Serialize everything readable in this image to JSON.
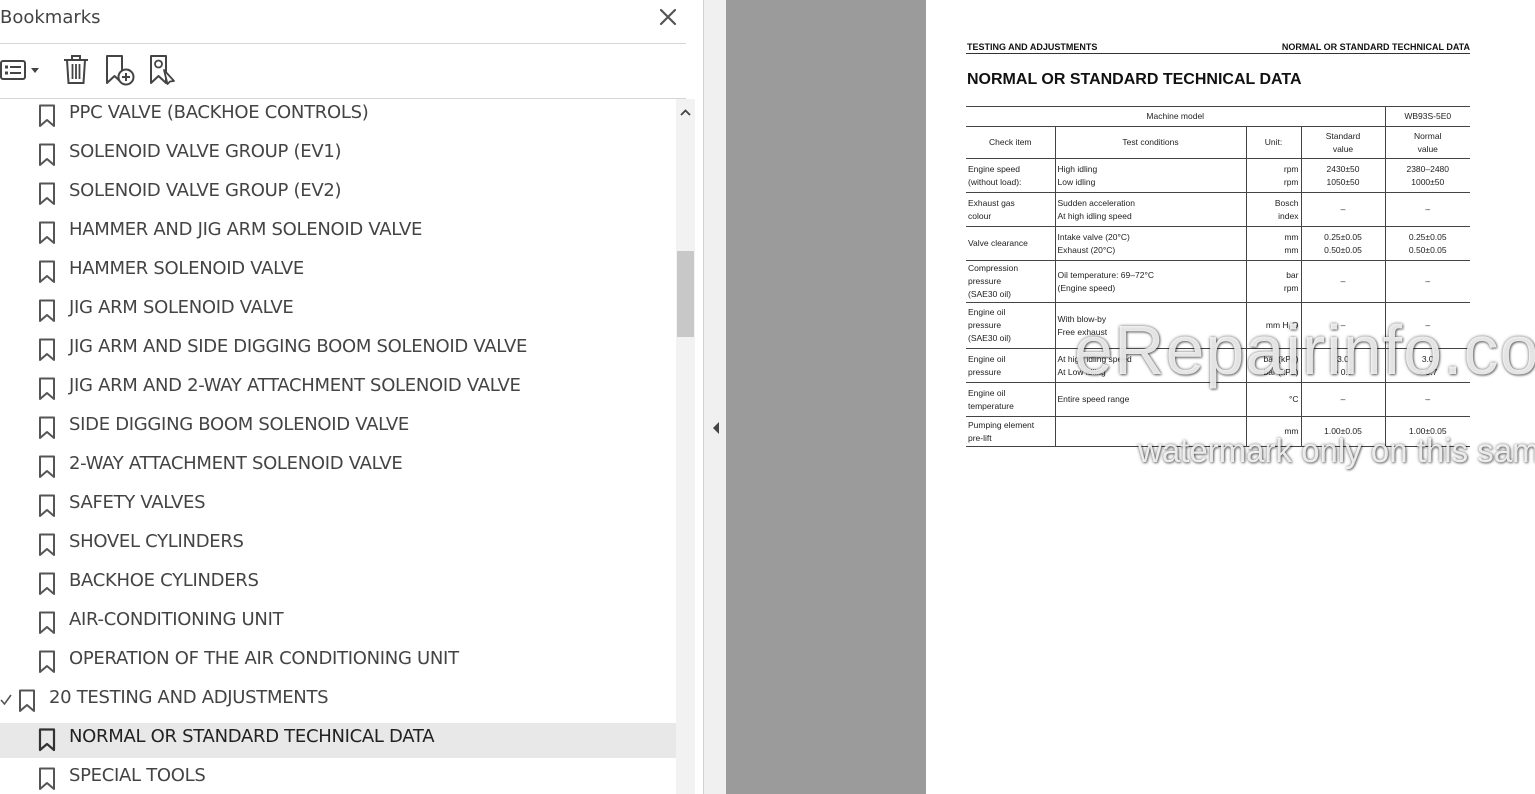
{
  "panel": {
    "title": "Bookmarks",
    "toolbar": {
      "options_icon": "list-options-icon",
      "delete_icon": "trash-icon",
      "new_bookmark_icon": "new-bookmark-icon",
      "find_bookmark_icon": "find-current-bookmark-icon"
    },
    "items": [
      {
        "label": "PPC VALVE (BACKHOE CONTROLS)",
        "level": 2,
        "selected": false
      },
      {
        "label": "SOLENOID VALVE GROUP (EV1)",
        "level": 2,
        "selected": false
      },
      {
        "label": "SOLENOID VALVE GROUP (EV2)",
        "level": 2,
        "selected": false
      },
      {
        "label": "HAMMER AND JIG ARM SOLENOID VALVE",
        "level": 2,
        "selected": false
      },
      {
        "label": "HAMMER SOLENOID VALVE",
        "level": 2,
        "selected": false
      },
      {
        "label": "JIG ARM SOLENOID VALVE",
        "level": 2,
        "selected": false
      },
      {
        "label": "JIG ARM AND SIDE DIGGING BOOM SOLENOID VALVE",
        "level": 2,
        "selected": false
      },
      {
        "label": "JIG ARM AND 2-WAY ATTACHMENT SOLENOID VALVE",
        "level": 2,
        "selected": false
      },
      {
        "label": "SIDE DIGGING BOOM SOLENOID VALVE",
        "level": 2,
        "selected": false
      },
      {
        "label": "2-WAY ATTACHMENT SOLENOID VALVE",
        "level": 2,
        "selected": false
      },
      {
        "label": "SAFETY VALVES",
        "level": 2,
        "selected": false
      },
      {
        "label": "SHOVEL CYLINDERS",
        "level": 2,
        "selected": false
      },
      {
        "label": "BACKHOE CYLINDERS",
        "level": 2,
        "selected": false
      },
      {
        "label": "AIR-CONDITIONING UNIT",
        "level": 2,
        "selected": false
      },
      {
        "label": "OPERATION OF THE AIR CONDITIONING UNIT",
        "level": 2,
        "selected": false
      },
      {
        "label": "20 TESTING AND ADJUSTMENTS",
        "level": 1,
        "selected": false,
        "expanded": true
      },
      {
        "label": "NORMAL OR STANDARD TECHNICAL DATA",
        "level": 2,
        "selected": true
      },
      {
        "label": "SPECIAL TOOLS",
        "level": 2,
        "selected": false
      }
    ]
  },
  "document": {
    "header_left": "TESTING AND ADJUSTMENTS",
    "header_right": "NORMAL OR STANDARD TECHNICAL DATA",
    "title": "NORMAL OR STANDARD TECHNICAL DATA",
    "table": {
      "machine_model_label": "Machine model",
      "machine_model_value": "WB93S-5E0",
      "col_check_item": "Check item",
      "col_test_conditions": "Test conditions",
      "col_unit": "Unit:",
      "col_standard": [
        "Standard",
        "value"
      ],
      "col_normal": [
        "Normal",
        "value"
      ],
      "rows": [
        {
          "item": [
            "Engine speed",
            "(without load):"
          ],
          "cond": [
            "High idling",
            "Low idling"
          ],
          "unit": [
            "rpm",
            "rpm"
          ],
          "std": [
            "2430±50",
            "1050±50"
          ],
          "norm": [
            "2380–2480",
            "1000±50"
          ]
        },
        {
          "item": [
            "Exhaust gas",
            "colour"
          ],
          "cond": [
            "Sudden acceleration",
            "At high idling speed"
          ],
          "unit": [
            "Bosch",
            "index"
          ],
          "std": [
            "–"
          ],
          "norm": [
            "–"
          ]
        },
        {
          "item": [
            "Valve clearance"
          ],
          "cond": [
            "Intake valve (20°C)",
            "Exhaust (20°C)"
          ],
          "unit": [
            "mm",
            "mm"
          ],
          "std": [
            "0.25±0.05",
            "0.50±0.05"
          ],
          "norm": [
            "0.25±0.05",
            "0.50±0.05"
          ]
        },
        {
          "item": [
            "Compression",
            "pressure",
            "(SAE30 oil)"
          ],
          "cond": [
            "Oil temperature: 69–72°C",
            "(Engine speed)"
          ],
          "unit": [
            "bar",
            "rpm"
          ],
          "std": [
            "–"
          ],
          "norm": [
            "–"
          ]
        },
        {
          "item": [
            "Engine oil",
            "pressure",
            "(SAE30 oil)"
          ],
          "cond": [
            "With blow-by",
            "Free exhaust"
          ],
          "unit": [
            "mm H₂O"
          ],
          "std": [
            "–"
          ],
          "norm": [
            "–"
          ]
        },
        {
          "item": [
            "Engine oil",
            "pressure"
          ],
          "cond": [
            "At high idling speed",
            "At Low idling"
          ],
          "unit": [
            "bar (kPa)",
            "bar (kPa)"
          ],
          "std": [
            "3.0",
            "> 0.7"
          ],
          "norm": [
            "3.0",
            "> 0.7"
          ]
        },
        {
          "item": [
            "Engine oil",
            "temperature"
          ],
          "cond": [
            "Entire speed range"
          ],
          "unit": [
            "°C"
          ],
          "std": [
            "–"
          ],
          "norm": [
            "–"
          ]
        },
        {
          "item": [
            "Pumping element",
            "pre-lift"
          ],
          "cond": [
            ""
          ],
          "unit": [
            "mm"
          ],
          "std": [
            "1.00±0.05"
          ],
          "norm": [
            "1.00±0.05"
          ]
        }
      ]
    },
    "watermark_main": "eRepairinfo.com",
    "watermark_sub": "watermark only on this sample"
  }
}
